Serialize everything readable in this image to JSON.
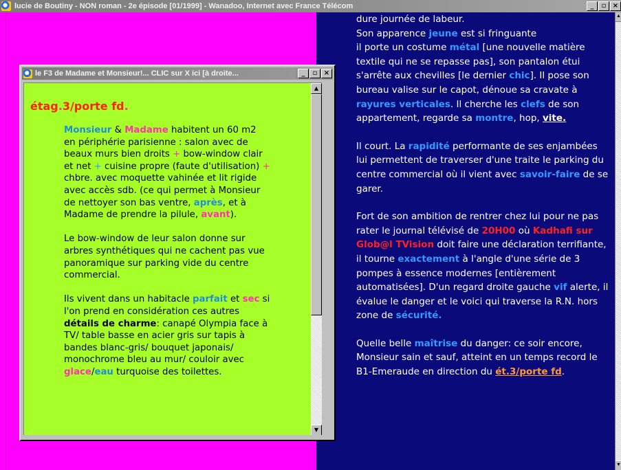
{
  "main_window": {
    "title": "lucie de Boutiny - NON roman - 2e épisode [01/1999] - Wanadoo, Internet avec France Télécom",
    "buttons": {
      "minimize": "_",
      "restore": "▫",
      "close": "×"
    }
  },
  "story": {
    "p1": [
      {
        "t": "dure journée de labeur.",
        "s": ""
      },
      {
        "br": true
      },
      {
        "t": "Son apparence ",
        "s": ""
      },
      {
        "t": "jeune",
        "s": "blue"
      },
      {
        "t": " est si fringuante",
        "s": ""
      },
      {
        "br": true
      },
      {
        "t": "il porte un costume ",
        "s": ""
      },
      {
        "t": "métal",
        "s": "blue"
      },
      {
        "t": " [une nouvelle matière textile qui ne se repasse pas], son pantalon étui s'arrête aux chevilles [le dernier ",
        "s": ""
      },
      {
        "t": "chic",
        "s": "blue"
      },
      {
        "t": "]. Il pose son bureau valise sur le capot, dénoue sa cravate à ",
        "s": ""
      },
      {
        "t": "rayures verticales",
        "s": "blue"
      },
      {
        "t": ". Il cherche les ",
        "s": ""
      },
      {
        "t": "clefs",
        "s": "blue"
      },
      {
        "t": " de son appartement, regarde sa ",
        "s": ""
      },
      {
        "t": "montre",
        "s": "blue"
      },
      {
        "t": ", hop, ",
        "s": ""
      },
      {
        "t": "vite.",
        "s": "link"
      }
    ],
    "p2": [
      {
        "t": "Il court. La ",
        "s": ""
      },
      {
        "t": "rapidité",
        "s": "blue"
      },
      {
        "t": " performante de ses enjambées lui permettent de traverser d'une traite le parking du centre commercial où il vient avec ",
        "s": ""
      },
      {
        "t": "savoir-faire",
        "s": "blue"
      },
      {
        "t": " de se garer.",
        "s": ""
      }
    ],
    "p3": [
      {
        "t": "Fort de son ambition de rentrer chez lui pour ne pas rater le journal télévisé de ",
        "s": ""
      },
      {
        "t": "20H00",
        "s": "red"
      },
      {
        "t": " où ",
        "s": ""
      },
      {
        "t": "Kadhafi sur Glob@l TVision",
        "s": "red"
      },
      {
        "t": " doit faire une déclaration terrifiante,",
        "s": ""
      },
      {
        "br": true
      },
      {
        "t": "il tourne ",
        "s": ""
      },
      {
        "t": "exactement",
        "s": "blue"
      },
      {
        "t": " à l'angle d'une série de 3 pompes à essence modernes [entièrement automatisées]. D'un regard droite gauche ",
        "s": ""
      },
      {
        "t": "vif",
        "s": "blue"
      },
      {
        "t": " alerte, il évalue le danger et le voici qui traverse la R.N. hors zone de ",
        "s": ""
      },
      {
        "t": "sécurité.",
        "s": "blue"
      }
    ],
    "p4": [
      {
        "t": "Quelle belle ",
        "s": ""
      },
      {
        "t": "maîtrise",
        "s": "blue"
      },
      {
        "t": " du danger: ce soir encore, Monsieur sain et sauf, atteint en un temps record le B1-Emeraude en direction du ",
        "s": ""
      },
      {
        "t": "ét.3/porte fd",
        "s": "orange"
      },
      {
        "t": ".",
        "s": ""
      }
    ]
  },
  "popup": {
    "title": "le F3 de Madame et Monsieur!... CLIC sur X ici [à droite...",
    "heading_a": "étag",
    "heading_b": ".",
    "heading_c": "3/porte fd",
    "heading_d": ".",
    "p1": [
      {
        "t": "Monsieur",
        "s": "cyan"
      },
      {
        "t": " & ",
        "s": ""
      },
      {
        "t": "Madame",
        "s": "pink"
      },
      {
        "t": " habitent un 60 m2 en périphérie parisienne : salon avec de beaux murs bien droits ",
        "s": ""
      },
      {
        "t": "+",
        "s": "pinkplus"
      },
      {
        "t": " bow-window clair et net ",
        "s": ""
      },
      {
        "t": "+",
        "s": "blueplus"
      },
      {
        "t": " cuisine propre (faute d'utilisation) ",
        "s": ""
      },
      {
        "t": "+",
        "s": "pinkplus"
      },
      {
        "t": " chbre. avec moquette vahinée et lit rigide avec accès sdb. (ce qui permet à Monsieur de nettoyer son bas ventre, ",
        "s": ""
      },
      {
        "t": "après",
        "s": "cyan"
      },
      {
        "t": ", et à Madame de prendre la pilule, ",
        "s": ""
      },
      {
        "t": "avant",
        "s": "pink"
      },
      {
        "t": ").",
        "s": ""
      }
    ],
    "p2": [
      {
        "t": "Le bow-window de leur salon donne sur arbres synthétiques qui ne cachent pas vue panoramique sur parking vide du centre commercial.",
        "s": ""
      }
    ],
    "p3": [
      {
        "t": "Ils vivent dans un habitacle ",
        "s": ""
      },
      {
        "t": "parfait",
        "s": "cyan"
      },
      {
        "t": " et ",
        "s": ""
      },
      {
        "t": "sec",
        "s": "pink"
      },
      {
        "t": " si l'on prend en considération ces autres ",
        "s": ""
      },
      {
        "t": "détails de charme",
        "s": "strong"
      },
      {
        "t": ": canapé Olympia face à TV/ table basse en acier gris sur tapis à bandes blanc-gris/ bouquet japonais/ monochrome bleu au mur/ couloir avec ",
        "s": ""
      },
      {
        "t": "glace",
        "s": "pink"
      },
      {
        "t": "/",
        "s": ""
      },
      {
        "t": "eau",
        "s": "cyan"
      },
      {
        "t": " turquoise des toilettes.",
        "s": ""
      }
    ]
  },
  "colors": {
    "background": "#ff00ff",
    "story_background": "#0a0a7a",
    "popup_background": "#a7ff29",
    "highlight_blue": "#3399ff",
    "highlight_red": "#ff2222",
    "highlight_pink": "#ff33aa",
    "link_orange": "#ff9933",
    "heading_red": "#ff2200"
  }
}
